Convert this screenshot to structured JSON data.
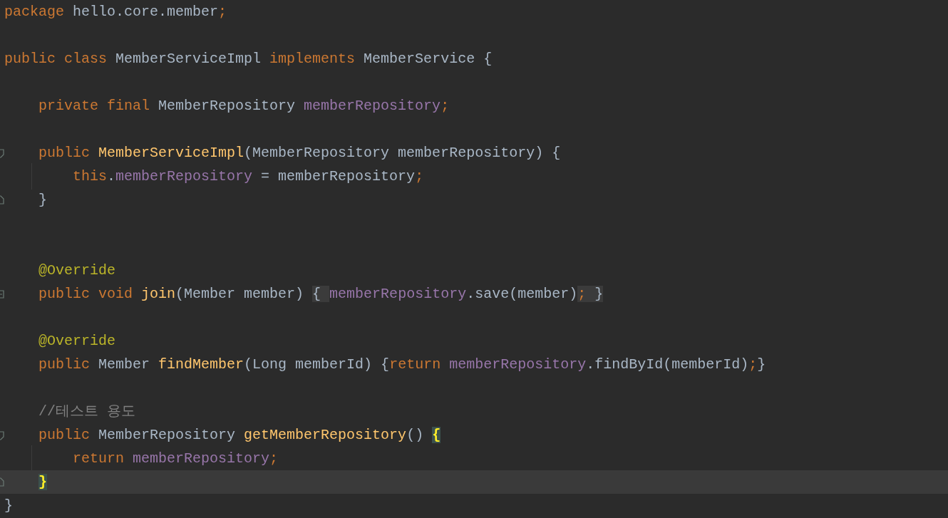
{
  "editor": {
    "lines": [
      {
        "current": false,
        "tokens": [
          {
            "text": "package ",
            "kind": "keyword"
          },
          {
            "text": "hello.core.member",
            "kind": "plain"
          },
          {
            "text": ";",
            "kind": "punct"
          }
        ]
      },
      {
        "current": false
      },
      {
        "current": false,
        "tokens": [
          {
            "text": "public class ",
            "kind": "keyword"
          },
          {
            "text": "MemberServiceImpl ",
            "kind": "plain"
          },
          {
            "text": "implements ",
            "kind": "keyword"
          },
          {
            "text": "MemberService {",
            "kind": "plain"
          }
        ]
      },
      {
        "current": false
      },
      {
        "current": false,
        "tokens": [
          {
            "text": "    private final ",
            "kind": "keyword"
          },
          {
            "text": "MemberRepository ",
            "kind": "plain"
          },
          {
            "text": "memberRepository",
            "kind": "field"
          },
          {
            "text": ";",
            "kind": "punct"
          }
        ]
      },
      {
        "current": false
      },
      {
        "current": false,
        "fold_start": true,
        "tokens": [
          {
            "text": "    public ",
            "kind": "keyword"
          },
          {
            "text": "MemberServiceImpl",
            "kind": "method"
          },
          {
            "text": "(MemberRepository memberRepository) {",
            "kind": "plain"
          }
        ]
      },
      {
        "current": false,
        "tokens": [
          {
            "text": "        this",
            "kind": "keyword"
          },
          {
            "text": ".",
            "kind": "plain"
          },
          {
            "text": "memberRepository",
            "kind": "field"
          },
          {
            "text": " = memberRepository",
            "kind": "plain"
          },
          {
            "text": ";",
            "kind": "punct"
          }
        ]
      },
      {
        "current": false,
        "fold_end": true,
        "tokens": [
          {
            "text": "    }",
            "kind": "plain"
          }
        ]
      },
      {
        "current": false
      },
      {
        "current": false
      },
      {
        "current": false,
        "tokens": [
          {
            "text": "    @Override",
            "kind": "annotation"
          }
        ]
      },
      {
        "current": false,
        "collapsed": true,
        "tokens": [
          {
            "text": "    public void ",
            "kind": "keyword"
          },
          {
            "text": "join",
            "kind": "method"
          },
          {
            "text": "(Member member) ",
            "kind": "plain"
          },
          {
            "text": "{ ",
            "kind": "folded"
          },
          {
            "text": "memberRepository",
            "kind": "field"
          },
          {
            "text": ".save(member)",
            "kind": "plain"
          },
          {
            "text": ";",
            "kind": "folded-punct"
          },
          {
            "text": " }",
            "kind": "folded"
          }
        ]
      },
      {
        "current": false
      },
      {
        "current": false,
        "tokens": [
          {
            "text": "    @Override",
            "kind": "annotation"
          }
        ]
      },
      {
        "current": false,
        "tokens": [
          {
            "text": "    public ",
            "kind": "keyword"
          },
          {
            "text": "Member ",
            "kind": "plain"
          },
          {
            "text": "findMember",
            "kind": "method"
          },
          {
            "text": "(Long memberId) {",
            "kind": "plain"
          },
          {
            "text": "return ",
            "kind": "keyword"
          },
          {
            "text": "memberRepository",
            "kind": "field"
          },
          {
            "text": ".findById(memberId)",
            "kind": "plain"
          },
          {
            "text": ";",
            "kind": "punct"
          },
          {
            "text": "}",
            "kind": "plain"
          }
        ]
      },
      {
        "current": false
      },
      {
        "current": false,
        "tokens": [
          {
            "text": "    //테스트 용도",
            "kind": "comment"
          }
        ]
      },
      {
        "current": false,
        "fold_start": true,
        "tokens": [
          {
            "text": "    public ",
            "kind": "keyword"
          },
          {
            "text": "MemberRepository ",
            "kind": "plain"
          },
          {
            "text": "getMemberRepository",
            "kind": "method"
          },
          {
            "text": "() ",
            "kind": "plain"
          },
          {
            "text": "{",
            "kind": "brace-match"
          }
        ]
      },
      {
        "current": false,
        "tokens": [
          {
            "text": "        return ",
            "kind": "keyword"
          },
          {
            "text": "memberRepository",
            "kind": "field"
          },
          {
            "text": ";",
            "kind": "punct"
          }
        ]
      },
      {
        "current": true,
        "fold_end": true,
        "tokens": [
          {
            "text": "    }",
            "kind": "brace-match"
          }
        ]
      },
      {
        "current": false,
        "tokens": [
          {
            "text": "}",
            "kind": "plain"
          }
        ]
      }
    ]
  }
}
